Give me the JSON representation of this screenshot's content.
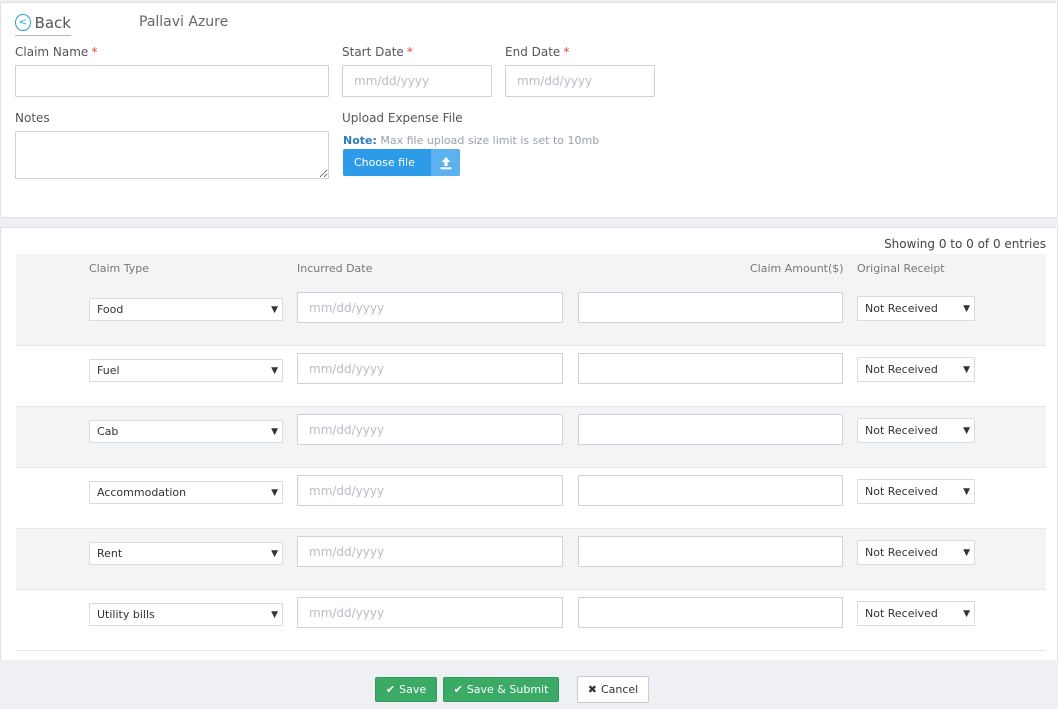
{
  "header": {
    "back_label": "Back",
    "user_name": "Pallavi Azure"
  },
  "form": {
    "claim_name": {
      "label": "Claim Name",
      "required": "*",
      "value": "",
      "placeholder": ""
    },
    "start_date": {
      "label": "Start Date",
      "required": "*",
      "placeholder": "mm/dd/yyyy"
    },
    "end_date": {
      "label": "End Date",
      "required": "*",
      "placeholder": "mm/dd/yyyy"
    },
    "notes": {
      "label": "Notes",
      "value": ""
    },
    "upload": {
      "label": "Upload Expense File",
      "note_prefix": "Note:",
      "note_text": "Max file upload size limit is set to 10mb",
      "button_label": "Choose file",
      "icon": "upload-icon"
    }
  },
  "table": {
    "info": "Showing 0 to 0 of 0 entries",
    "columns": [
      "Claim Type",
      "Incurred Date",
      "Claim Amount($)",
      "Original Receipt"
    ],
    "date_placeholder": "mm/dd/yyyy",
    "rows": [
      {
        "claim_type": "Food",
        "receipt": "Not Received"
      },
      {
        "claim_type": "Fuel",
        "receipt": "Not Received"
      },
      {
        "claim_type": "Cab",
        "receipt": "Not Received"
      },
      {
        "claim_type": "Accommodation",
        "receipt": "Not Received"
      },
      {
        "claim_type": "Rent",
        "receipt": "Not Received"
      },
      {
        "claim_type": "Utility bills",
        "receipt": "Not Received"
      }
    ]
  },
  "footer": {
    "save_label": "Save",
    "save_submit_label": "Save & Submit",
    "cancel_label": "Cancel"
  },
  "colors": {
    "accent": "#2d9be8",
    "success": "#3aaa66",
    "required": "#e0463c"
  }
}
